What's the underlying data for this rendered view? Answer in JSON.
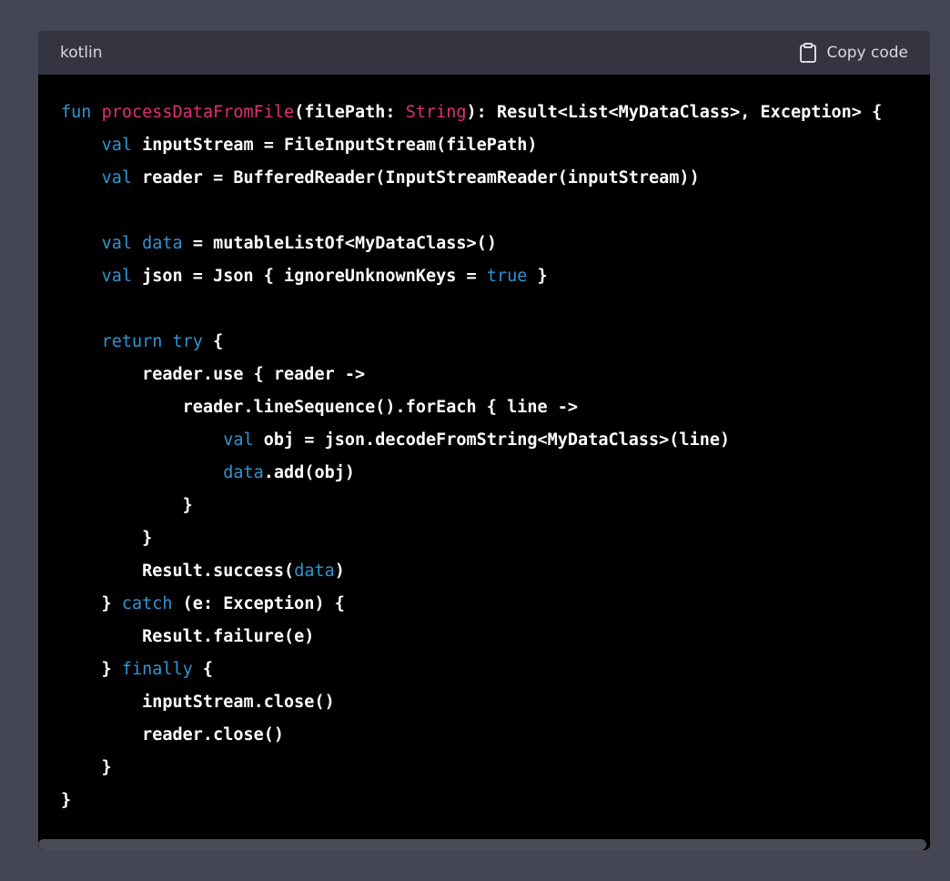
{
  "code_block": {
    "language": "kotlin",
    "copy_label": "Copy code",
    "colors": {
      "background": "#000000",
      "header": "#343541",
      "keyword": "#2e95d3",
      "function_name": "#df3079",
      "text": "#ffffff"
    },
    "lines": [
      [
        {
          "t": "fun",
          "c": "kw"
        },
        {
          "t": " "
        },
        {
          "t": "processDataFromFile",
          "c": "fn"
        },
        {
          "t": "(filePath: "
        },
        {
          "t": "String",
          "c": "fn"
        },
        {
          "t": "): Result<List<MyDataClass>, Exception> {"
        }
      ],
      [
        {
          "t": "    "
        },
        {
          "t": "val",
          "c": "kw"
        },
        {
          "t": " inputStream = FileInputStream(filePath)"
        }
      ],
      [
        {
          "t": "    "
        },
        {
          "t": "val",
          "c": "kw"
        },
        {
          "t": " reader = BufferedReader(InputStreamReader(inputStream))"
        }
      ],
      [],
      [
        {
          "t": "    "
        },
        {
          "t": "val",
          "c": "kw"
        },
        {
          "t": " "
        },
        {
          "t": "data",
          "c": "kw"
        },
        {
          "t": " = mutableListOf<MyDataClass>()"
        }
      ],
      [
        {
          "t": "    "
        },
        {
          "t": "val",
          "c": "kw"
        },
        {
          "t": " json = Json { ignoreUnknownKeys = "
        },
        {
          "t": "true",
          "c": "kw"
        },
        {
          "t": " }"
        }
      ],
      [],
      [
        {
          "t": "    "
        },
        {
          "t": "return",
          "c": "kw"
        },
        {
          "t": " "
        },
        {
          "t": "try",
          "c": "kw"
        },
        {
          "t": " {"
        }
      ],
      [
        {
          "t": "        reader.use { reader ->"
        }
      ],
      [
        {
          "t": "            reader.lineSequence().forEach { line ->"
        }
      ],
      [
        {
          "t": "                "
        },
        {
          "t": "val",
          "c": "kw"
        },
        {
          "t": " obj = json.decodeFromString<MyDataClass>(line)"
        }
      ],
      [
        {
          "t": "                "
        },
        {
          "t": "data",
          "c": "kw"
        },
        {
          "t": ".add(obj)"
        }
      ],
      [
        {
          "t": "            }"
        }
      ],
      [
        {
          "t": "        }"
        }
      ],
      [
        {
          "t": "        Result.success("
        },
        {
          "t": "data",
          "c": "kw"
        },
        {
          "t": ")"
        }
      ],
      [
        {
          "t": "    } "
        },
        {
          "t": "catch",
          "c": "kw"
        },
        {
          "t": " (e: Exception) {"
        }
      ],
      [
        {
          "t": "        Result.failure(e)"
        }
      ],
      [
        {
          "t": "    } "
        },
        {
          "t": "finally",
          "c": "kw"
        },
        {
          "t": " {"
        }
      ],
      [
        {
          "t": "        inputStream.close()"
        }
      ],
      [
        {
          "t": "        reader.close()"
        }
      ],
      [
        {
          "t": "    }"
        }
      ],
      [
        {
          "t": "}"
        }
      ]
    ]
  },
  "icons": {
    "copy": "clipboard-icon"
  }
}
